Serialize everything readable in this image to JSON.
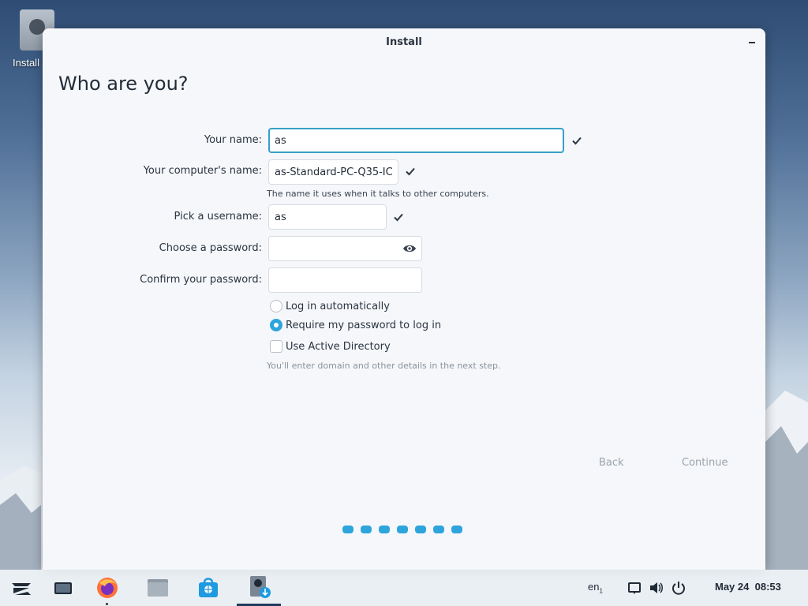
{
  "desktop": {
    "icon_label": "Install"
  },
  "window": {
    "title": "Install"
  },
  "page": {
    "heading": "Who are you?"
  },
  "form": {
    "name_label": "Your name:",
    "name_value": "as",
    "computer_label": "Your computer's name:",
    "computer_value": "as-Standard-PC-Q35-IC",
    "computer_hint": "The name it uses when it talks to other computers.",
    "username_label": "Pick a username:",
    "username_value": "as",
    "password_label": "Choose a password:",
    "password_value": "",
    "confirm_label": "Confirm your password:",
    "confirm_value": ""
  },
  "options": {
    "login_auto": "Log in automatically",
    "login_password": "Require my password to log in",
    "login_selected": "login_password",
    "active_directory": "Use Active Directory",
    "active_directory_checked": false,
    "active_directory_hint": "You'll enter domain and other details in the next step."
  },
  "nav": {
    "back": "Back",
    "continue": "Continue"
  },
  "progress": {
    "total_steps": 7
  },
  "taskbar": {
    "keyboard_layout": "en",
    "keyboard_layout_sub": "1",
    "date": "May 24",
    "time": "08:53"
  },
  "colors": {
    "accent": "#2da5dc",
    "focus_border": "#38a0c9"
  }
}
